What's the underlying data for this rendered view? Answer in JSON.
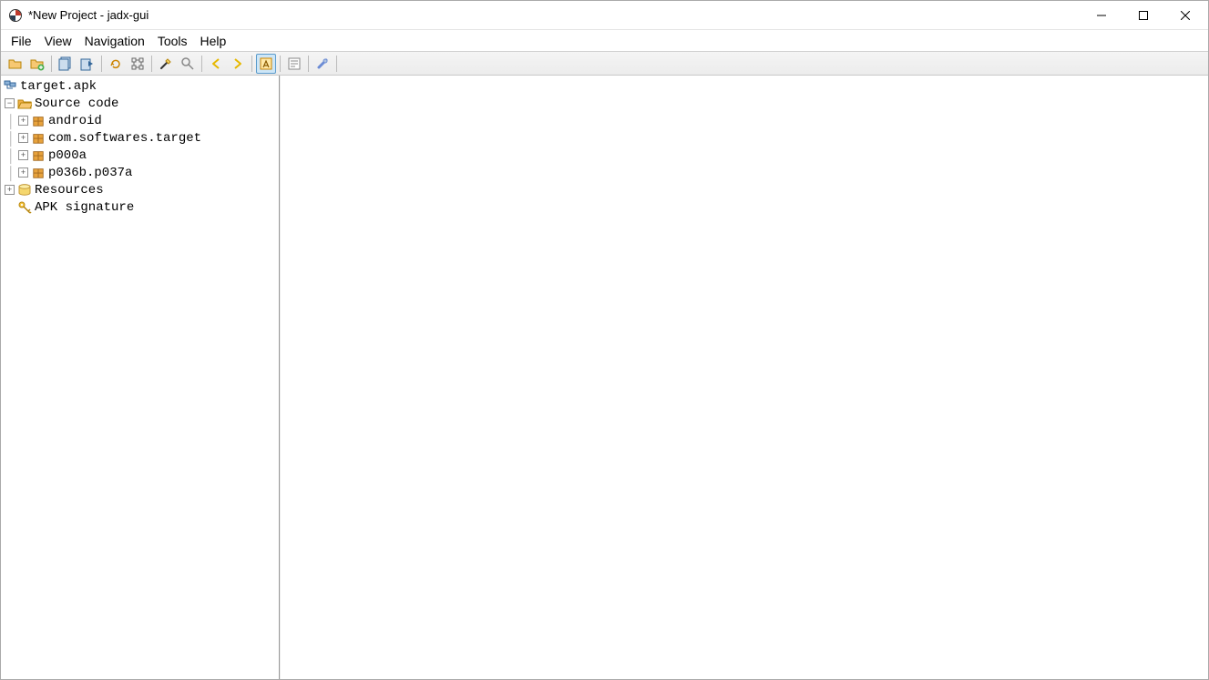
{
  "window": {
    "title": "*New Project - jadx-gui"
  },
  "menu": {
    "file": "File",
    "view": "View",
    "navigation": "Navigation",
    "tools": "Tools",
    "help": "Help"
  },
  "toolbar": {
    "open": "open",
    "add_files": "add-files",
    "copy": "copy",
    "paste": "paste",
    "sync": "sync",
    "flatten": "flatten",
    "wand": "wand",
    "search": "search",
    "back": "back",
    "forward": "forward",
    "highlight": "highlight",
    "log": "log",
    "prefs": "prefs"
  },
  "tree": {
    "root": "target.apk",
    "source_code": "Source code",
    "packages": {
      "p0": "android",
      "p1": "com.softwares.target",
      "p2": "p000a",
      "p3": "p036b.p037a"
    },
    "resources": "Resources",
    "apk_signature": "APK signature"
  }
}
